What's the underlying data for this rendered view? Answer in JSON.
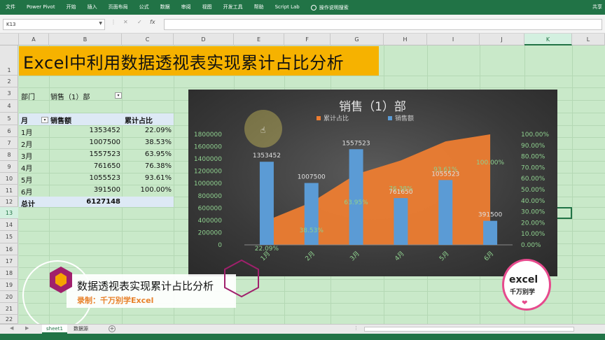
{
  "ribbon": {
    "tabs": [
      "文件",
      "Power Pivot",
      "开始",
      "插入",
      "页面布局",
      "公式",
      "数据",
      "审阅",
      "视图",
      "开发工具",
      "帮助",
      "Script Lab"
    ],
    "search_label": "操作说明搜索",
    "share_label": "共享"
  },
  "formula_bar": {
    "name_box": "K13",
    "cancel": "✕",
    "enter": "✓",
    "fx": "fx",
    "formula": ""
  },
  "columns": [
    "A",
    "B",
    "C",
    "D",
    "E",
    "F",
    "G",
    "H",
    "I",
    "J",
    "K",
    "L"
  ],
  "rows": [
    "1",
    "2",
    "3",
    "4",
    "5",
    "6",
    "7",
    "8",
    "9",
    "10",
    "11",
    "12",
    "13",
    "14",
    "15",
    "16",
    "17",
    "18",
    "19",
    "20",
    "21",
    "22"
  ],
  "sheet": {
    "title": "Excel中利用数据透视表实现累计占比分析",
    "filter_label": "部门",
    "filter_value": "销售（1）部",
    "pivot_headers": [
      "月",
      "销售额",
      "累计占比"
    ],
    "pivot_rows": [
      {
        "month": "1月",
        "sales": "1353452",
        "cum": "22.09%"
      },
      {
        "month": "2月",
        "sales": "1007500",
        "cum": "38.53%"
      },
      {
        "month": "3月",
        "sales": "1557523",
        "cum": "63.95%"
      },
      {
        "month": "4月",
        "sales": "761650",
        "cum": "76.38%"
      },
      {
        "month": "5月",
        "sales": "1055523",
        "cum": "93.61%"
      },
      {
        "month": "6月",
        "sales": "391500",
        "cum": "100.00%"
      }
    ],
    "total_label": "总计",
    "total_value": "6127148"
  },
  "chart_data": {
    "type": "bar",
    "title": "销售（1）部",
    "categories": [
      "1月",
      "2月",
      "3月",
      "4月",
      "5月",
      "6月"
    ],
    "series": [
      {
        "name": "销售额",
        "type": "bar",
        "color": "#5b9bd5",
        "values": [
          1353452,
          1007500,
          1557523,
          761650,
          1055523,
          391500
        ],
        "labels": [
          "1353452",
          "1007500",
          "1557523",
          "761650",
          "1055523",
          "391500"
        ]
      },
      {
        "name": "累计占比",
        "type": "area",
        "color": "#ed7d31",
        "values": [
          0.2209,
          0.3853,
          0.6395,
          0.7638,
          0.9361,
          1.0
        ],
        "labels": [
          "22.09%",
          "38.53%",
          "63.95%",
          "76.38%",
          "93.61%",
          "100.00%"
        ]
      }
    ],
    "y_left": {
      "ticks": [
        "1800000",
        "1600000",
        "1400000",
        "1200000",
        "1000000",
        "800000",
        "600000",
        "400000",
        "200000",
        "0"
      ],
      "min": 0,
      "max": 1800000
    },
    "y_right": {
      "ticks": [
        "100.00%",
        "90.00%",
        "80.00%",
        "70.00%",
        "60.00%",
        "50.00%",
        "40.00%",
        "30.00%",
        "20.00%",
        "10.00%",
        "0.00%"
      ],
      "min": 0,
      "max": 1
    },
    "legend_position": "top"
  },
  "sheet_tabs": [
    "sheet1",
    "数据源"
  ],
  "active_tab": "sheet1",
  "overlay": {
    "line1": "数据透视表实现累计占比分析",
    "line2": "录制：千万别学Excel",
    "logo_line1": "excel",
    "logo_line2": "千万别学"
  },
  "colors": {
    "accent": "#217346",
    "title_fill": "#f6b200",
    "sheet_bg": "#c9e9c9"
  }
}
